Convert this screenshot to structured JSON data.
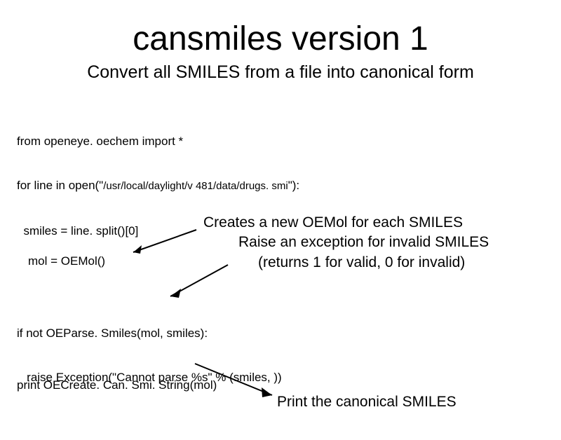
{
  "title": "cansmiles version 1",
  "subtitle": "Convert all SMILES from a file into canonical form",
  "code": {
    "line1": "from openeye. oechem import *",
    "line2a": "for line in open(\"",
    "line2b": "/usr/local/daylight/v 481/data/drugs. smi",
    "line2c": "\"):",
    "line3": "  smiles = line. split()[0]",
    "mol": "mol = OEMol()",
    "parse1": "if not OEParse. Smiles(mol, smiles):",
    "parse2": "   raise Exception(\"Cannot parse %s\" % (smiles, ))",
    "print": "print OECreate. Can. Smi. String(mol)"
  },
  "annotations": {
    "a1": "Creates a new OEMol for each SMILES",
    "a2": "Raise an exception for invalid SMILES",
    "a3": "(returns 1 for valid, 0 for invalid)",
    "final": "Print the canonical SMILES"
  }
}
